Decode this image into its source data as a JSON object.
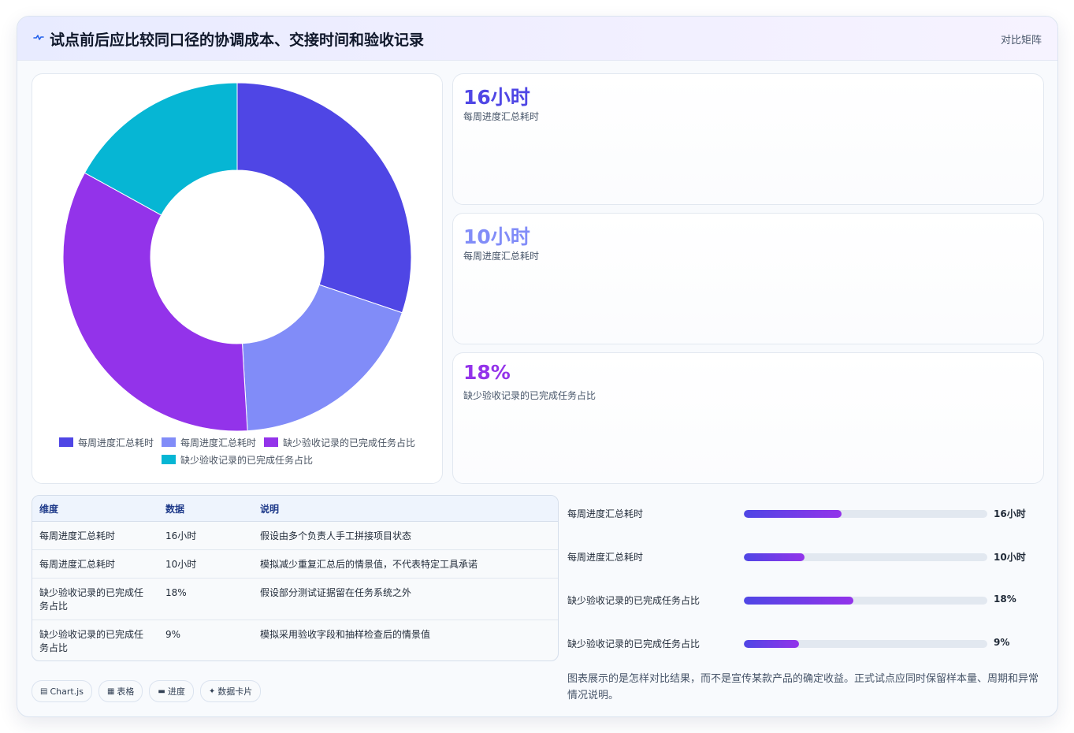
{
  "header": {
    "title": "试点前后应比较同口径的协调成本、交接时间和验收记录",
    "tag": "对比矩阵"
  },
  "colors": {
    "indigo": "#4f46e5",
    "periwinkle": "#818cf8",
    "purple": "#9333ea",
    "cyan": "#06b6d4"
  },
  "chart_data": {
    "type": "pie",
    "variant": "doughnut",
    "labels": [
      "每周进度汇总耗时",
      "每周进度汇总耗时",
      "缺少验收记录的已完成任务占比",
      "缺少验收记录的已完成任务占比"
    ],
    "values": [
      16,
      10,
      18,
      9
    ],
    "colors": [
      "#4f46e5",
      "#818cf8",
      "#9333ea",
      "#06b6d4"
    ],
    "legend_position": "bottom"
  },
  "stats": [
    {
      "value": "16小时",
      "label": "每周进度汇总耗时",
      "color": "#4f46e5"
    },
    {
      "value": "10小时",
      "label": "每周进度汇总耗时",
      "color": "#818cf8"
    },
    {
      "value": "18%",
      "label": "缺少验收记录的已完成任务占比",
      "color": "#9333ea"
    }
  ],
  "table": {
    "headers": [
      "维度",
      "数据",
      "说明"
    ],
    "rows": [
      [
        "每周进度汇总耗时",
        "16小时",
        "假设由多个负责人手工拼接项目状态"
      ],
      [
        "每周进度汇总耗时",
        "10小时",
        "模拟减少重复汇总后的情景值，不代表特定工具承诺"
      ],
      [
        "缺少验收记录的已完成任务占比",
        "18%",
        "假设部分测试证据留在任务系统之外"
      ],
      [
        "缺少验收记录的已完成任务占比",
        "9%",
        "模拟采用验收字段和抽样检查后的情景值"
      ]
    ]
  },
  "progress": [
    {
      "label": "每周进度汇总耗时",
      "value": "16小时",
      "fraction": 0.4
    },
    {
      "label": "每周进度汇总耗时",
      "value": "10小时",
      "fraction": 0.25
    },
    {
      "label": "缺少验收记录的已完成任务占比",
      "value": "18%",
      "fraction": 0.45
    },
    {
      "label": "缺少验收记录的已完成任务占比",
      "value": "9%",
      "fraction": 0.225
    }
  ],
  "note": "图表展示的是怎样对比结果，而不是宣传某款产品的确定收益。正式试点应同时保留样本量、周期和异常情况说明。",
  "chips": [
    {
      "icon": "chart-icon",
      "glyph": "▤",
      "label": "Chart.js"
    },
    {
      "icon": "table-icon",
      "glyph": "▦",
      "label": "表格"
    },
    {
      "icon": "progress-icon",
      "glyph": "▬",
      "label": "进度"
    },
    {
      "icon": "sparkle-icon",
      "glyph": "✦",
      "label": "数据卡片"
    }
  ]
}
